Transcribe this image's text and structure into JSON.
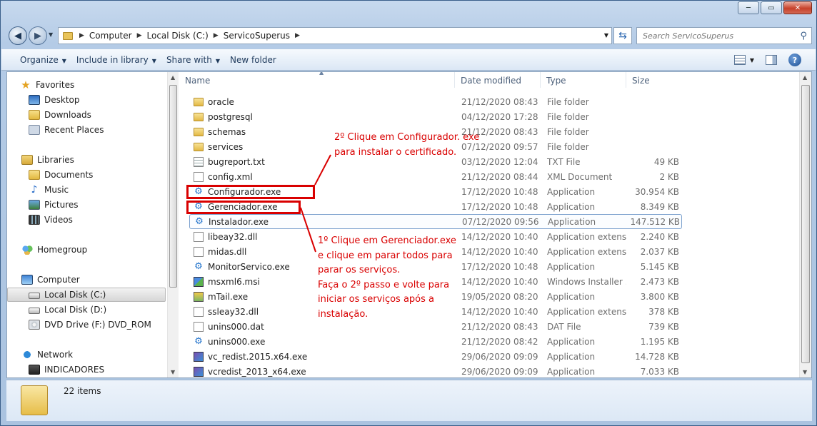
{
  "window": {
    "buttons": [
      "─",
      "▭",
      "✕"
    ]
  },
  "navigation": {
    "back_icon": "◀",
    "forward_icon": "▶",
    "address": {
      "segments": [
        "Computer",
        "Local Disk (C:)",
        "ServicoSuperus"
      ]
    },
    "search_placeholder": "Search ServicoSuperus"
  },
  "toolbar": {
    "organize": "Organize",
    "include_in_library": "Include in library",
    "share_with": "Share with",
    "new_folder": "New folder",
    "help": "?"
  },
  "sidebar": {
    "favorites": "Favorites",
    "desktop": "Desktop",
    "downloads": "Downloads",
    "recent_places": "Recent Places",
    "libraries": "Libraries",
    "documents": "Documents",
    "music": "Music",
    "pictures": "Pictures",
    "videos": "Videos",
    "homegroup": "Homegroup",
    "computer": "Computer",
    "local_disk_c": "Local Disk (C:)",
    "local_disk_d": "Local Disk (D:)",
    "dvd_drive": "DVD Drive (F:) DVD_ROM",
    "network": "Network",
    "indicadores": "INDICADORES"
  },
  "columns": {
    "name": "Name",
    "date_modified": "Date modified",
    "type": "Type",
    "size": "Size"
  },
  "files": [
    {
      "name": "oracle",
      "date": "21/12/2020 08:43",
      "type": "File folder",
      "size": "",
      "icon": "folder"
    },
    {
      "name": "postgresql",
      "date": "04/12/2020 17:28",
      "type": "File folder",
      "size": "",
      "icon": "folder"
    },
    {
      "name": "schemas",
      "date": "21/12/2020 08:43",
      "type": "File folder",
      "size": "",
      "icon": "folder"
    },
    {
      "name": "services",
      "date": "07/12/2020 09:57",
      "type": "File folder",
      "size": "",
      "icon": "folder"
    },
    {
      "name": "bugreport.txt",
      "date": "03/12/2020 12:04",
      "type": "TXT File",
      "size": "49 KB",
      "icon": "txt"
    },
    {
      "name": "config.xml",
      "date": "21/12/2020 08:44",
      "type": "XML Document",
      "size": "2 KB",
      "icon": "xml"
    },
    {
      "name": "Configurador.exe",
      "date": "17/12/2020 10:48",
      "type": "Application",
      "size": "30.954 KB",
      "icon": "app"
    },
    {
      "name": "Gerenciador.exe",
      "date": "17/12/2020 10:48",
      "type": "Application",
      "size": "8.349 KB",
      "icon": "app"
    },
    {
      "name": "Instalador.exe",
      "date": "07/12/2020 09:56",
      "type": "Application",
      "size": "147.512 KB",
      "icon": "app"
    },
    {
      "name": "libeay32.dll",
      "date": "14/12/2020 10:40",
      "type": "Application extens...",
      "size": "2.240 KB",
      "icon": "dll"
    },
    {
      "name": "midas.dll",
      "date": "14/12/2020 10:40",
      "type": "Application extens...",
      "size": "2.037 KB",
      "icon": "dll"
    },
    {
      "name": "MonitorServico.exe",
      "date": "17/12/2020 10:48",
      "type": "Application",
      "size": "5.145 KB",
      "icon": "app"
    },
    {
      "name": "msxml6.msi",
      "date": "14/12/2020 10:40",
      "type": "Windows Installer ...",
      "size": "2.473 KB",
      "icon": "msi"
    },
    {
      "name": "mTail.exe",
      "date": "19/05/2020 08:20",
      "type": "Application",
      "size": "3.800 KB",
      "icon": "mtail"
    },
    {
      "name": "ssleay32.dll",
      "date": "14/12/2020 10:40",
      "type": "Application extens...",
      "size": "378 KB",
      "icon": "dll"
    },
    {
      "name": "unins000.dat",
      "date": "21/12/2020 08:43",
      "type": "DAT File",
      "size": "739 KB",
      "icon": "dat"
    },
    {
      "name": "unins000.exe",
      "date": "21/12/2020 08:42",
      "type": "Application",
      "size": "1.195 KB",
      "icon": "app"
    },
    {
      "name": "vc_redist.2015.x64.exe",
      "date": "29/06/2020 09:09",
      "type": "Application",
      "size": "14.728 KB",
      "icon": "vc"
    },
    {
      "name": "vcredist_2013_x64.exe",
      "date": "29/06/2020 09:09",
      "type": "Application",
      "size": "7.033 KB",
      "icon": "vc"
    }
  ],
  "annotations": {
    "step2": [
      "2º Clique em Configurador. exe",
      "para instalar o certificado."
    ],
    "step1": [
      "1º Clique em Gerenciador.exe",
      "e clique em parar todos para",
      "parar os serviços.",
      "Faça o 2º passo e volte para",
      "iniciar os serviços após a",
      "instalação."
    ]
  },
  "status": {
    "item_count": "22 items"
  },
  "colors": {
    "annotation_red": "#d90000",
    "selection_border": "#7da2ce"
  }
}
